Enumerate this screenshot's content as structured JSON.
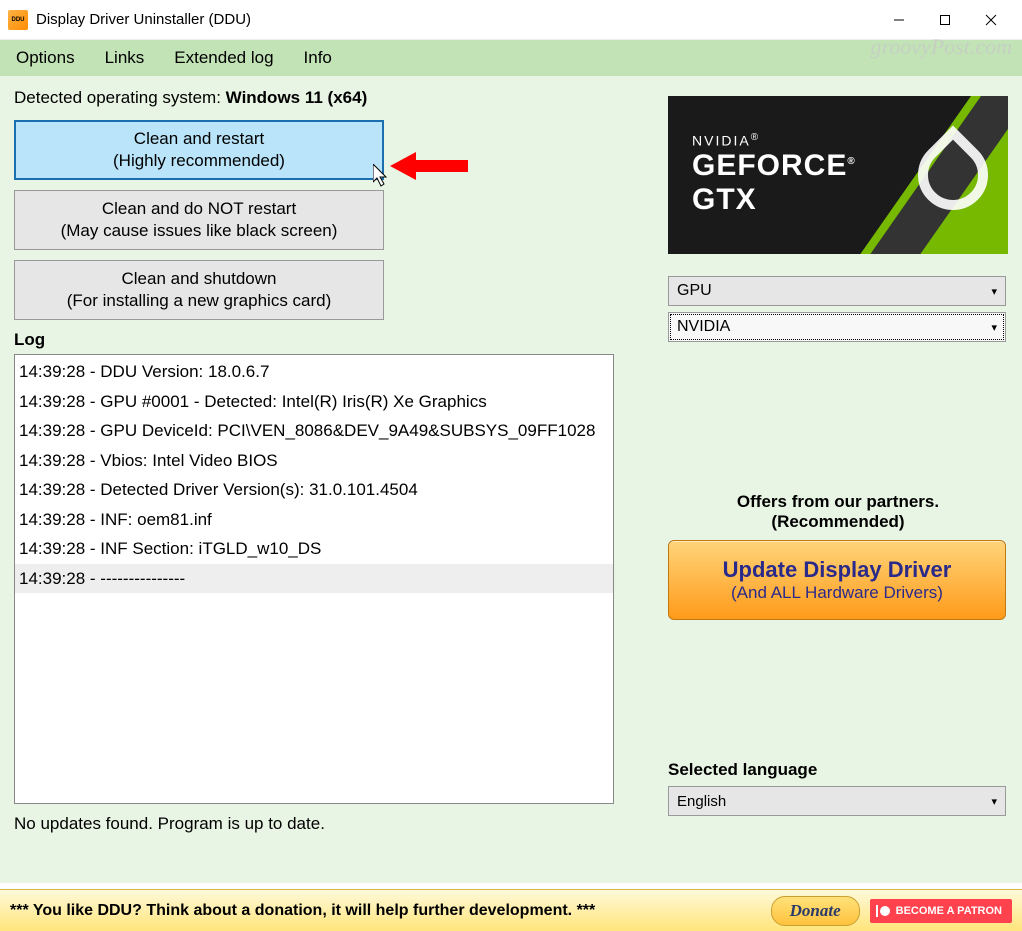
{
  "window": {
    "title": "Display Driver Uninstaller (DDU)"
  },
  "menu": {
    "options": "Options",
    "links": "Links",
    "extended_log": "Extended log",
    "info": "Info"
  },
  "os": {
    "label": "Detected operating system: ",
    "value": "Windows 11 (x64)"
  },
  "buttons": {
    "clean_restart_l1": "Clean and restart",
    "clean_restart_l2": "(Highly recommended)",
    "clean_norestart_l1": "Clean and do NOT restart",
    "clean_norestart_l2": "(May cause issues like black screen)",
    "clean_shutdown_l1": "Clean and shutdown",
    "clean_shutdown_l2": "(For installing a new graphics card)"
  },
  "log": {
    "heading": "Log",
    "rows": [
      "14:39:28 - DDU Version: 18.0.6.7",
      "14:39:28 - GPU #0001 - Detected: Intel(R) Iris(R) Xe Graphics",
      "14:39:28 - GPU DeviceId: PCI\\VEN_8086&DEV_9A49&SUBSYS_09FF1028",
      "14:39:28 - Vbios: Intel Video BIOS",
      "14:39:28 - Detected Driver Version(s): 31.0.101.4504",
      "14:39:28 - INF: oem81.inf",
      "14:39:28 - INF Section: iTGLD_w10_DS",
      "14:39:28 - ---------------"
    ]
  },
  "status": "No updates found. Program is up to date.",
  "gpu_banner": {
    "l1": "NVIDIA",
    "l2": "GEFORCE",
    "l3": "GTX"
  },
  "device_type": "GPU",
  "vendor": "NVIDIA",
  "partners_label": "Offers from our partners. (Recommended)",
  "update_btn": {
    "t1": "Update Display Driver",
    "t2": "(And ALL Hardware Drivers)"
  },
  "lang": {
    "label": "Selected language",
    "value": "English"
  },
  "footer": {
    "text": "*** You like DDU? Think about a donation, it will help further development. ***",
    "donate": "Donate",
    "patron": "BECOME A PATRON"
  },
  "watermark": "groovyPost.com"
}
